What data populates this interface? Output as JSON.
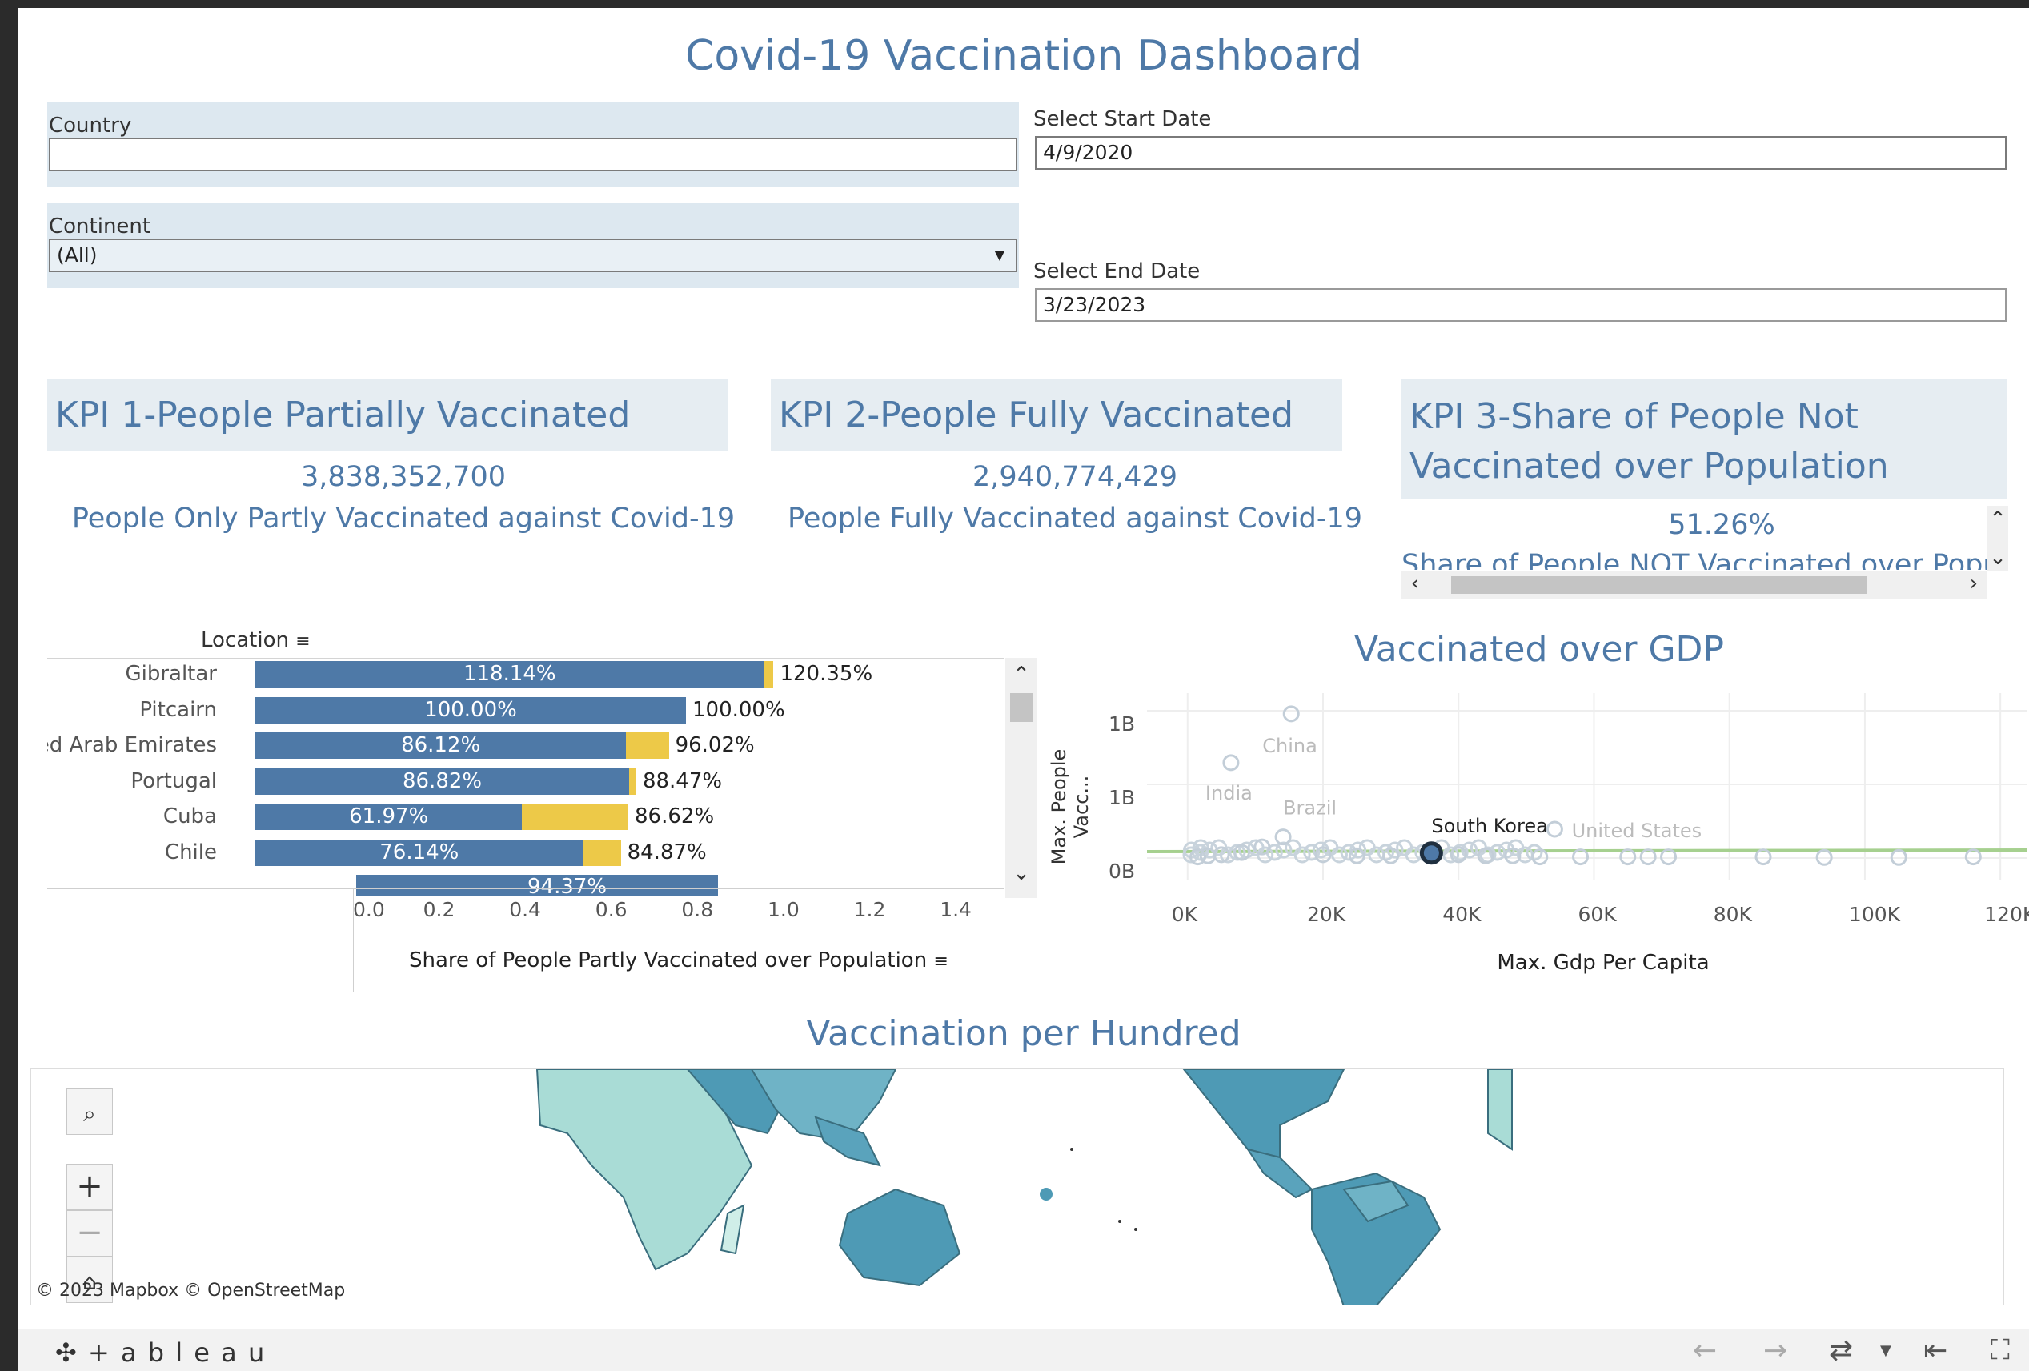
{
  "dashboard": {
    "title": "Covid-19 Vaccination Dashboard"
  },
  "filters": {
    "country_label": "Country",
    "country_value": "",
    "continent_label": "Continent",
    "continent_value": "(All)",
    "start_label": "Select Start Date",
    "start_value": "4/9/2020",
    "end_label": "Select End Date",
    "end_value": "3/23/2023"
  },
  "kpis": {
    "kpi1": {
      "title": "KPI 1-People Partially Vaccinated",
      "value": "3,838,352,700",
      "caption": "People Only Partly Vaccinated against Covid-19"
    },
    "kpi2": {
      "title": "KPI 2-People Fully Vaccinated",
      "value": "2,940,774,429",
      "caption": "People Fully Vaccinated against Covid-19"
    },
    "kpi3": {
      "title_line1": "KPI 3-Share of People Not",
      "title_line2": "Vaccinated over Population",
      "value": "51.26%",
      "caption": "Share of People NOT Vaccinated over Popul"
    }
  },
  "bar_chart": {
    "header": "Location",
    "xlabel": "Share of People Partly Vaccinated over Population",
    "ticks": [
      "0.0",
      "0.2",
      "0.4",
      "0.6",
      "0.8",
      "1.0",
      "1.2",
      "1.4"
    ],
    "partial_row_label": "94.37%"
  },
  "scatter": {
    "title": "Vaccinated over GDP",
    "xlabel": "Max. Gdp Per Capita",
    "ylabel": "Max. People Vacc...",
    "xticks": [
      "0K",
      "20K",
      "40K",
      "60K",
      "80K",
      "100K",
      "120K"
    ],
    "yticks": [
      "1B",
      "1B",
      "0B"
    ],
    "labels": {
      "china": "China",
      "india": "India",
      "brazil": "Brazil",
      "korea": "South Korea",
      "us": "United States"
    }
  },
  "map": {
    "title": "Vaccination per Hundred",
    "attribution": "© 2023 Mapbox © OpenStreetMap",
    "zoom_in": "+",
    "zoom_out": "−"
  },
  "footer": {
    "brand": "+ a b l e a u"
  },
  "chart_data": [
    {
      "type": "bar",
      "title": "",
      "xlabel": "Share of People Partly Vaccinated over Population",
      "ylabel": "Location",
      "xlim": [
        0,
        1.5
      ],
      "categories": [
        "Gibraltar",
        "Pitcairn",
        "United Arab Emirates",
        "Portugal",
        "Cuba",
        "Chile"
      ],
      "series": [
        {
          "name": "",
          "values": [
            1.1814,
            1.0,
            0.8612,
            0.8682,
            0.6197,
            0.7614
          ],
          "labels": [
            "118.14%",
            "100.00%",
            "86.12%",
            "86.82%",
            "61.97%",
            "76.14%"
          ]
        },
        {
          "name": "",
          "values": [
            1.2035,
            1.0,
            0.9602,
            0.8847,
            0.8662,
            0.8487
          ],
          "labels": [
            "120.35%",
            "100.00%",
            "96.02%",
            "88.47%",
            "86.62%",
            "84.87%"
          ]
        }
      ],
      "colors": [
        "#4e79a7",
        "#edc948"
      ]
    },
    {
      "type": "scatter",
      "title": "Vaccinated over GDP",
      "xlabel": "Max. Gdp Per Capita",
      "ylabel": "Max. People Vacc...",
      "xlim": [
        0,
        120000
      ],
      "points": [
        {
          "label": "China",
          "x": 15300,
          "y": 1.3
        },
        {
          "label": "India",
          "x": 6400,
          "y": 0.86
        },
        {
          "label": "Brazil",
          "x": 14100,
          "y": 0.19
        },
        {
          "label": "South Korea",
          "x": 36000,
          "y": 0.045
        },
        {
          "label": "United States",
          "x": 54200,
          "y": 0.26
        },
        {
          "label": "",
          "x": 85000,
          "y": 0.01
        },
        {
          "label": "",
          "x": 94000,
          "y": 0.005
        },
        {
          "label": "",
          "x": 105000,
          "y": 0.005
        },
        {
          "label": "",
          "x": 116000,
          "y": 0.01
        },
        {
          "label": "",
          "x": 65000,
          "y": 0.01
        },
        {
          "label": "",
          "x": 68000,
          "y": 0.01
        },
        {
          "label": "",
          "x": 71000,
          "y": 0.01
        },
        {
          "label": "",
          "x": 58000,
          "y": 0.01
        },
        {
          "label": "",
          "x": 52000,
          "y": 0.01
        },
        {
          "label": "",
          "x": 48000,
          "y": 0.02
        },
        {
          "label": "",
          "x": 44000,
          "y": 0.02
        },
        {
          "label": "",
          "x": 40000,
          "y": 0.03
        },
        {
          "label": "",
          "x": 30000,
          "y": 0.02
        },
        {
          "label": "",
          "x": 25000,
          "y": 0.02
        },
        {
          "label": "",
          "x": 20000,
          "y": 0.03
        },
        {
          "label": "",
          "x": 11000,
          "y": 0.1
        },
        {
          "label": "",
          "x": 8000,
          "y": 0.05
        },
        {
          "label": "",
          "x": 5000,
          "y": 0.03
        },
        {
          "label": "",
          "x": 3000,
          "y": 0.02
        },
        {
          "label": "",
          "x": 1500,
          "y": 0.01
        }
      ],
      "highlight": "South Korea",
      "trend_color": "#a6d08f"
    }
  ]
}
